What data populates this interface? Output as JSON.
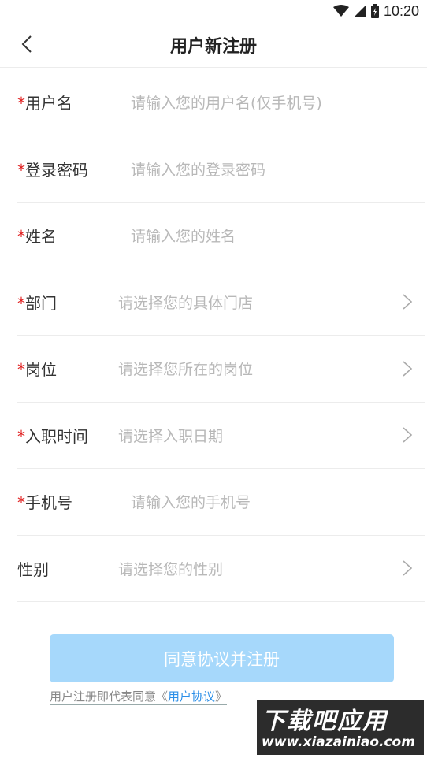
{
  "status_bar": {
    "time": "10:20"
  },
  "header": {
    "title": "用户新注册"
  },
  "form": {
    "required_mark": "*",
    "fields": [
      {
        "label": "用户名",
        "placeholder": "请输入您的用户名(仅手机号)",
        "required": true,
        "type": "input"
      },
      {
        "label": "登录密码",
        "placeholder": "请输入您的登录密码",
        "required": true,
        "type": "input"
      },
      {
        "label": "姓名",
        "placeholder": "请输入您的姓名",
        "required": true,
        "type": "input"
      },
      {
        "label": "部门",
        "placeholder": "请选择您的具体门店",
        "required": true,
        "type": "select"
      },
      {
        "label": "岗位",
        "placeholder": "请选择您所在的岗位",
        "required": true,
        "type": "select"
      },
      {
        "label": "入职时间",
        "placeholder": "请选择入职日期",
        "required": true,
        "type": "select"
      },
      {
        "label": "手机号",
        "placeholder": "请输入您的手机号",
        "required": true,
        "type": "input"
      },
      {
        "label": "性别",
        "placeholder": "请选择您的性别",
        "required": false,
        "type": "select"
      }
    ]
  },
  "submit": {
    "label": "同意协议并注册"
  },
  "agreement": {
    "prefix": "用户注册即代表同意",
    "open_quote": "《",
    "link_text": "用户协议",
    "close_quote": "》"
  },
  "watermark": {
    "title": "下载吧应用",
    "url": "www.xiazainiao.com"
  },
  "colors": {
    "required": "#e02020",
    "button_bg": "#a6d8fb",
    "link": "#2b8fe8",
    "placeholder": "#b8b8b8"
  }
}
